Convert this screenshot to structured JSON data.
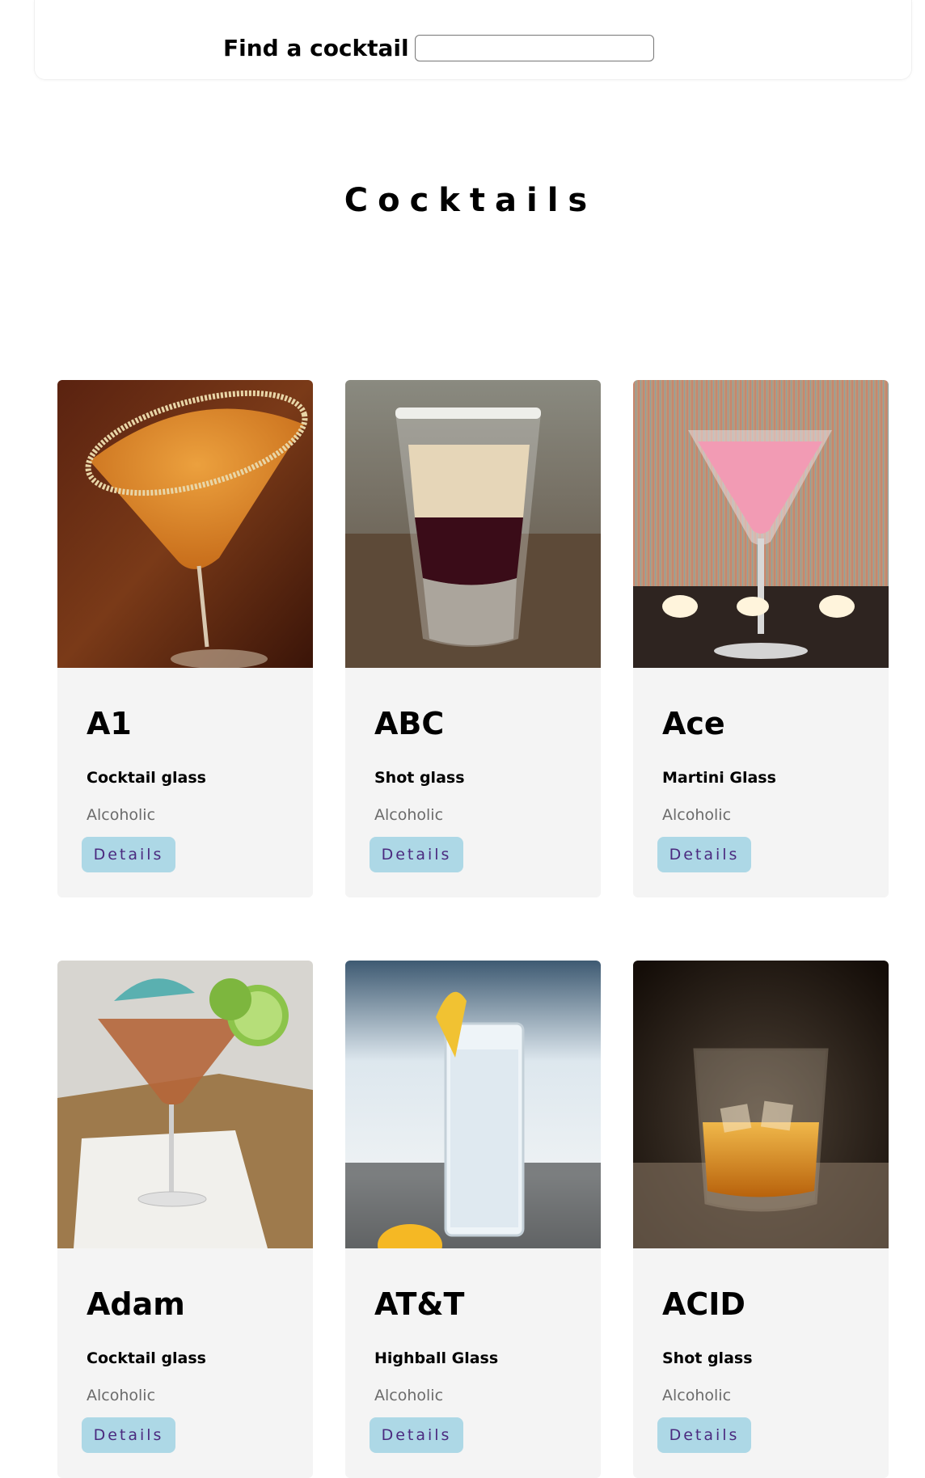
{
  "search": {
    "label": "Find a cocktail",
    "value": "",
    "placeholder": ""
  },
  "page_title": "Cocktails",
  "cocktails": [
    {
      "name": "A1",
      "glass": "Cocktail glass",
      "category": "Alcoholic",
      "button": "Details",
      "image": "cocktail-glass-orange-drink"
    },
    {
      "name": "ABC",
      "glass": "Shot glass",
      "category": "Alcoholic",
      "button": "Details",
      "image": "layered-shot"
    },
    {
      "name": "Ace",
      "glass": "Martini Glass",
      "category": "Alcoholic",
      "button": "Details",
      "image": "pink-martini-candles"
    },
    {
      "name": "Adam",
      "glass": "Cocktail glass",
      "category": "Alcoholic",
      "button": "Details",
      "image": "martini-lime-umbrella"
    },
    {
      "name": "AT&T",
      "glass": "Highball Glass",
      "category": "Alcoholic",
      "button": "Details",
      "image": "highball-lemon-ice"
    },
    {
      "name": "ACID",
      "glass": "Shot glass",
      "category": "Alcoholic",
      "button": "Details",
      "image": "whiskey-rocks-glass"
    }
  ],
  "colors": {
    "card_background": "#f4f4f4",
    "button_background": "#add8e6",
    "button_text": "#4b2a7f",
    "category_text": "#6b6b6b"
  }
}
